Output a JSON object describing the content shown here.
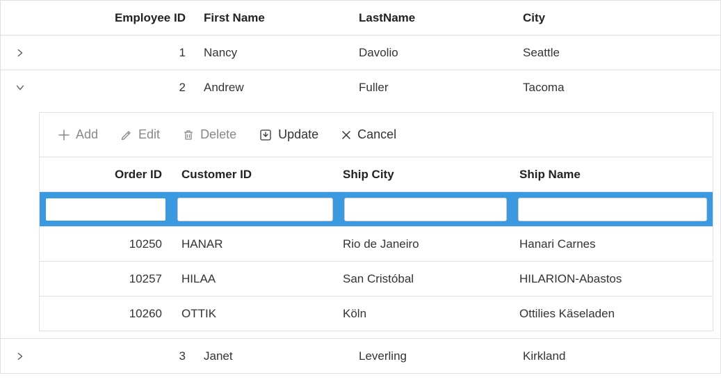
{
  "headers": {
    "employee_id": "Employee ID",
    "first_name": "First Name",
    "last_name": "LastName",
    "city": "City"
  },
  "rows": [
    {
      "id": "1",
      "first": "Nancy",
      "last": "Davolio",
      "city": "Seattle",
      "expanded": false
    },
    {
      "id": "2",
      "first": "Andrew",
      "last": "Fuller",
      "city": "Tacoma",
      "expanded": true
    },
    {
      "id": "3",
      "first": "Janet",
      "last": "Leverling",
      "city": "Kirkland",
      "expanded": false
    }
  ],
  "detail": {
    "toolbar": {
      "add": "Add",
      "edit": "Edit",
      "delete": "Delete",
      "update": "Update",
      "cancel": "Cancel"
    },
    "headers": {
      "order_id": "Order ID",
      "customer_id": "Customer ID",
      "ship_city": "Ship City",
      "ship_name": "Ship Name"
    },
    "insert_row": {
      "order_id": "",
      "customer_id": "",
      "ship_city": "",
      "ship_name": ""
    },
    "rows": [
      {
        "order": "10250",
        "cust": "HANAR",
        "ship": "Rio de Janeiro",
        "name": "Hanari Carnes"
      },
      {
        "order": "10257",
        "cust": "HILAA",
        "ship": "San Cristóbal",
        "name": "HILARION-Abastos"
      },
      {
        "order": "10260",
        "cust": "OTTIK",
        "ship": "Köln",
        "name": "Ottilies Käseladen"
      }
    ]
  }
}
